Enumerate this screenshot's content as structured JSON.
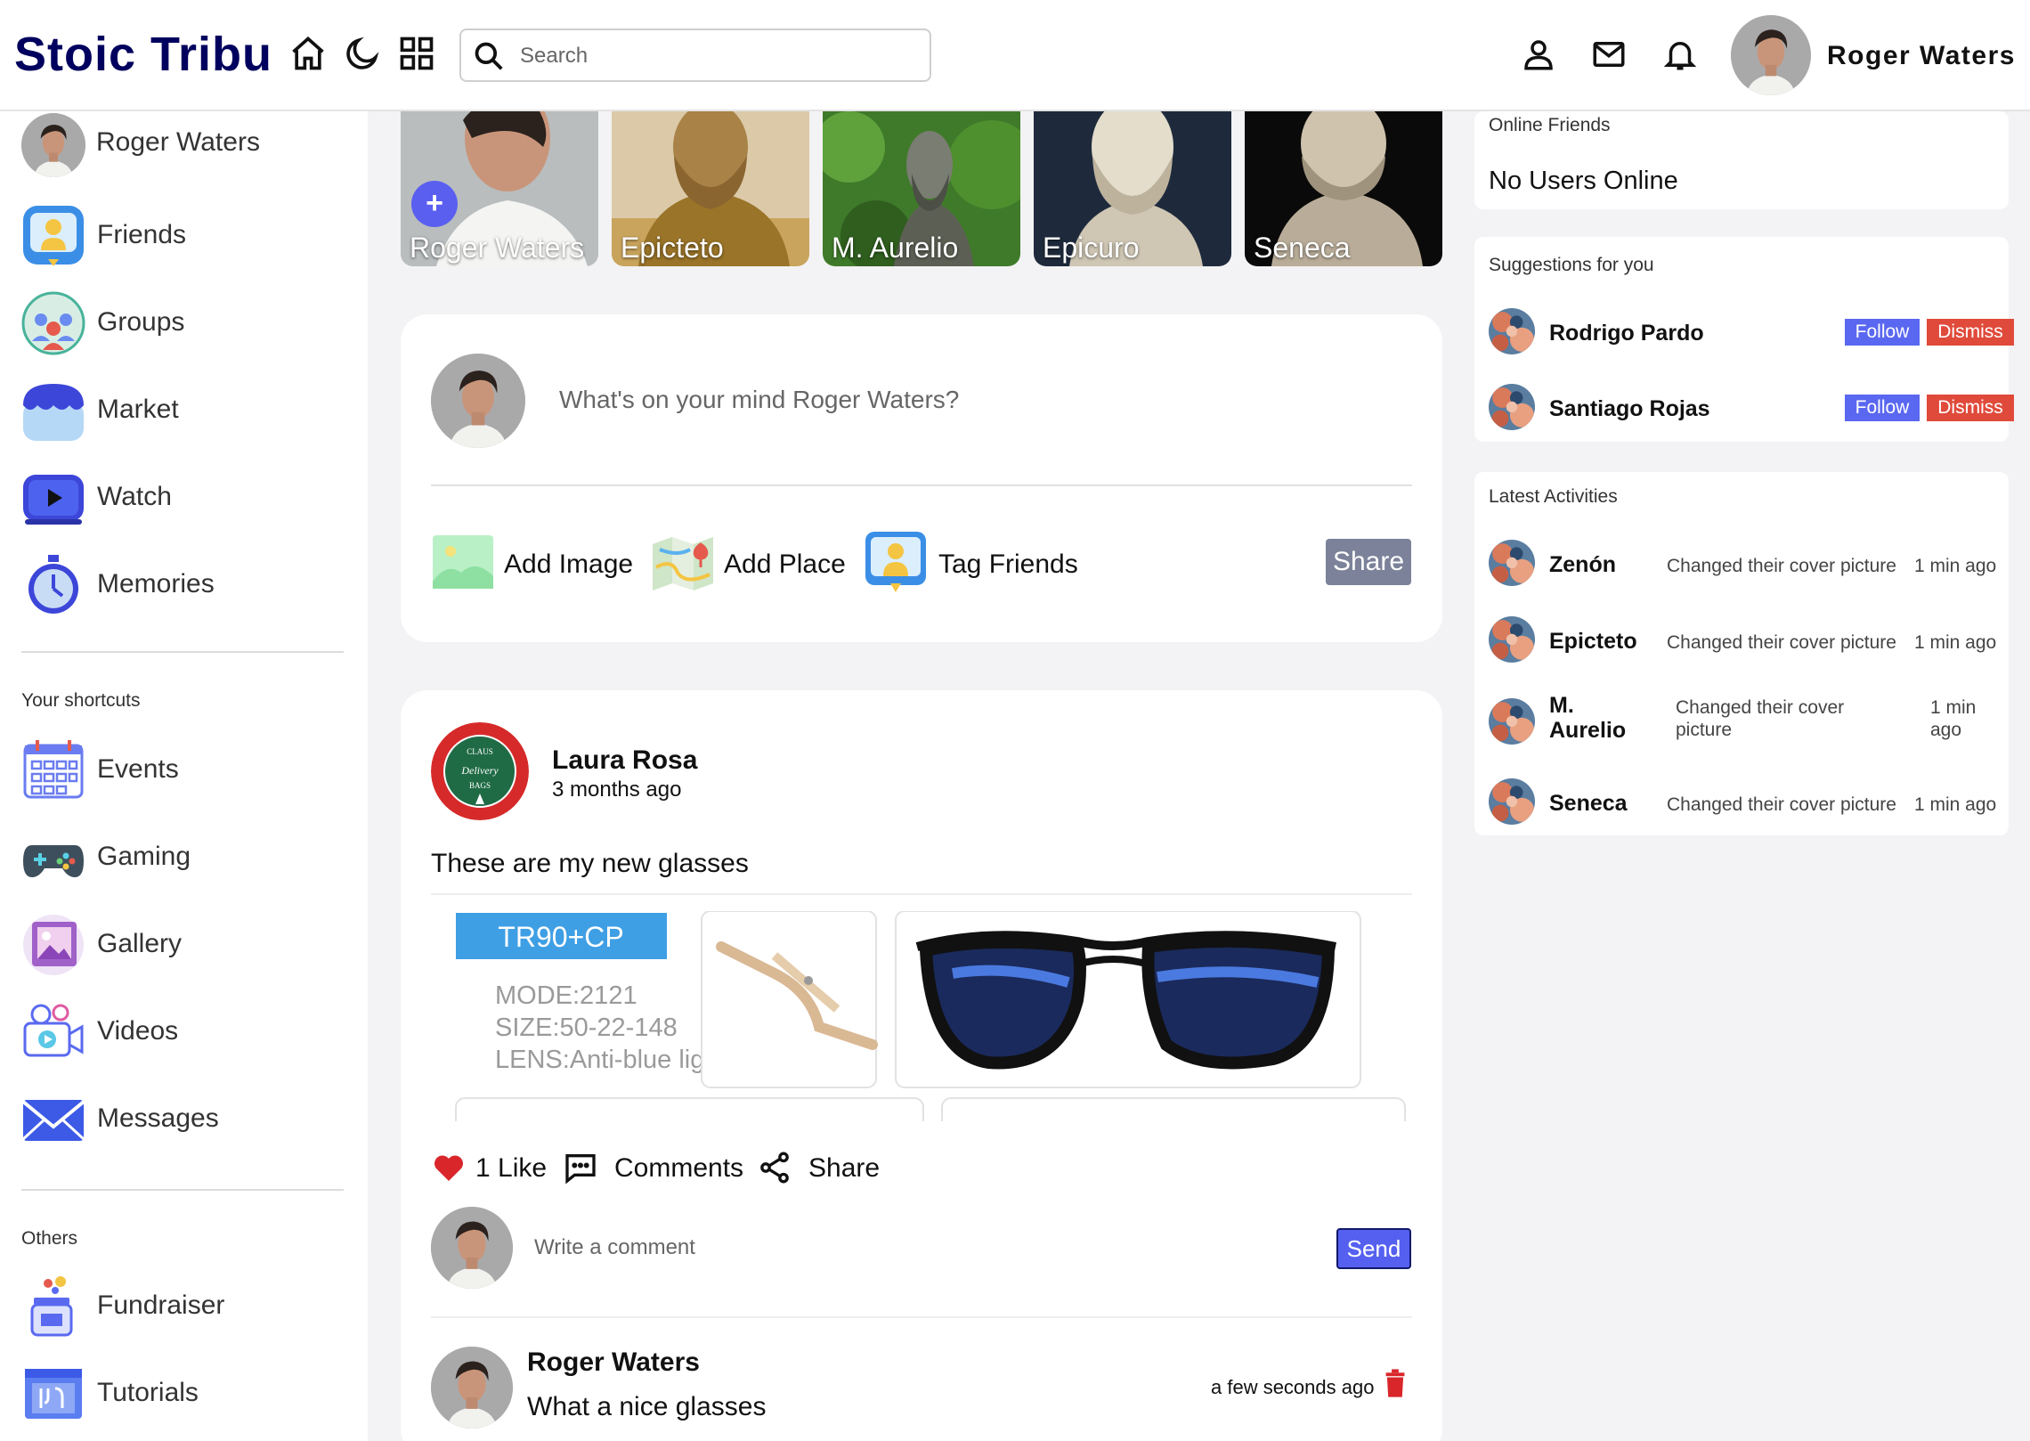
{
  "app": {
    "title": "Stoic Tribu"
  },
  "search": {
    "placeholder": "Search"
  },
  "user": {
    "name": "Roger Waters"
  },
  "sidebar": {
    "items": [
      {
        "label": "Roger Waters"
      },
      {
        "label": "Friends"
      },
      {
        "label": "Groups"
      },
      {
        "label": "Market"
      },
      {
        "label": "Watch"
      },
      {
        "label": "Memories"
      }
    ],
    "shortcuts_title": "Your shortcuts",
    "shortcuts": [
      {
        "label": "Events"
      },
      {
        "label": "Gaming"
      },
      {
        "label": "Gallery"
      },
      {
        "label": "Videos"
      },
      {
        "label": "Messages"
      }
    ],
    "others_title": "Others",
    "others": [
      {
        "label": "Fundraiser"
      },
      {
        "label": "Tutorials"
      }
    ]
  },
  "stories": [
    {
      "name": "Roger Waters"
    },
    {
      "name": "Epicteto"
    },
    {
      "name": "M. Aurelio"
    },
    {
      "name": "Epicuro"
    },
    {
      "name": "Seneca"
    }
  ],
  "composer": {
    "placeholder": "What's on your mind Roger Waters?",
    "actions": [
      {
        "label": "Add Image"
      },
      {
        "label": "Add Place"
      },
      {
        "label": "Tag Friends"
      }
    ],
    "share_label": "Share"
  },
  "post": {
    "author": "Laura Rosa",
    "time": "3 months ago",
    "text": "These are my new glasses",
    "avatar_text": {
      "line1": "CLAUS",
      "line2": "Delivery",
      "line3": "BAGS"
    },
    "image_text": {
      "badge": "TR90+CP",
      "model": "MODE:2121",
      "size": "SIZE:50-22-148",
      "lens": "LENS:Anti-blue light"
    },
    "likes_label": "1 Like",
    "comments_label": "Comments",
    "share_label": "Share",
    "comment_placeholder": "Write a comment",
    "send_label": "Send",
    "comment": {
      "author": "Roger Waters",
      "text": "What a nice glasses",
      "time": "a few seconds ago"
    }
  },
  "online": {
    "title": "Online Friends",
    "empty": "No Users Online"
  },
  "suggestions": {
    "title": "Suggestions for you",
    "follow_label": "Follow",
    "dismiss_label": "Dismiss",
    "items": [
      {
        "name": "Rodrigo Pardo"
      },
      {
        "name": "Santiago Rojas"
      }
    ]
  },
  "activities": {
    "title": "Latest Activities",
    "items": [
      {
        "name": "Zenón",
        "desc": "Changed their cover picture",
        "time": "1 min ago"
      },
      {
        "name": "Epicteto",
        "desc": "Changed their cover picture",
        "time": "1 min ago"
      },
      {
        "name": "M. Aurelio",
        "desc": "Changed their cover picture",
        "time": "1 min ago"
      },
      {
        "name": "Seneca",
        "desc": "Changed their cover picture",
        "time": "1 min ago"
      }
    ]
  },
  "colors": {
    "brand": "#00005e",
    "follow": "#5a67f0",
    "dismiss": "#e04a3b",
    "like": "#d9262b",
    "send": "#5560f0"
  },
  "icons": {
    "topbar": [
      "home-icon",
      "moon-icon",
      "grid-icon",
      "search-icon",
      "person-icon",
      "mail-icon",
      "bell-icon"
    ],
    "sidebar": [
      "friends-icon",
      "groups-icon",
      "market-icon",
      "watch-icon",
      "memories-icon",
      "events-icon",
      "gaming-icon",
      "gallery-icon",
      "videos-icon",
      "messages-icon",
      "fundraiser-icon",
      "tutorials-icon"
    ],
    "post": [
      "heart-icon",
      "comment-icon",
      "share-icon",
      "trash-icon"
    ]
  }
}
